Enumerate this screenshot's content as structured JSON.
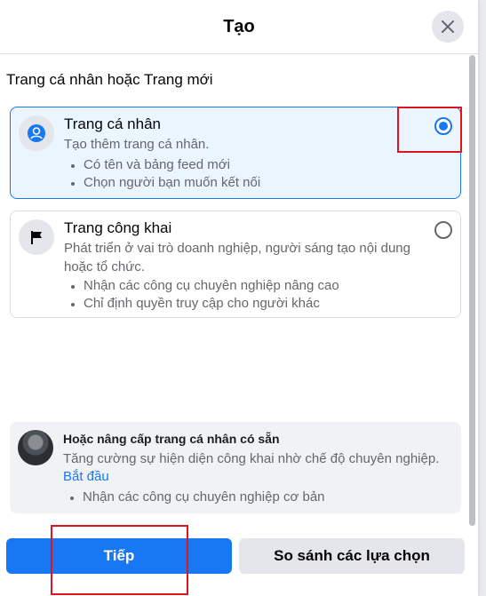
{
  "dialog": {
    "title": "Tạo",
    "close_icon": "close-icon"
  },
  "section": {
    "title": "Trang cá nhân hoặc Trang mới"
  },
  "options": [
    {
      "icon": "profile-icon",
      "title": "Trang cá nhân",
      "description": "Tạo thêm trang cá nhân.",
      "bullets": [
        "Có tên và bảng feed mới",
        "Chọn người bạn muốn kết nối"
      ],
      "selected": true
    },
    {
      "icon": "flag-icon",
      "title": "Trang công khai",
      "description": "Phát triển ở vai trò doanh nghiệp, người sáng tạo nội dung hoặc tổ chức.",
      "bullets": [
        "Nhận các công cụ chuyên nghiệp nâng cao",
        "Chỉ định quyền truy cập cho người khác"
      ],
      "selected": false
    }
  ],
  "upgrade": {
    "title": "Hoặc nâng cấp trang cá nhân có sẵn",
    "description": "Tăng cường sự hiện diện công khai nhờ chế độ chuyên nghiệp.",
    "link": "Bắt đầu",
    "bullets": [
      "Nhận các công cụ chuyên nghiệp cơ bản"
    ]
  },
  "footer": {
    "next_label": "Tiếp",
    "compare_label": "So sánh các lựa chọn"
  },
  "colors": {
    "accent": "#1877f2",
    "highlight": "#e0141e",
    "selected_bg": "#ebf5ff"
  }
}
